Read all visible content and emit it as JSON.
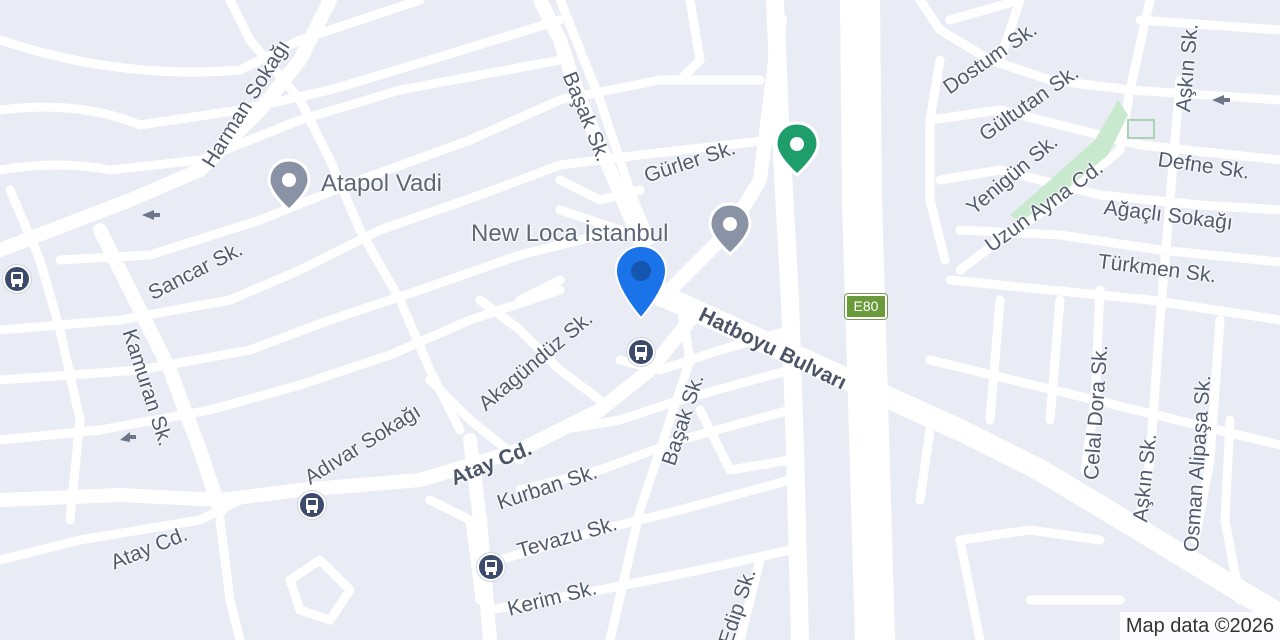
{
  "streets": [
    {
      "id": "harman",
      "name": "Harman Sokağı"
    },
    {
      "id": "basak-n",
      "name": "Başak Sk."
    },
    {
      "id": "gurler",
      "name": "Gürler Sk."
    },
    {
      "id": "dostum",
      "name": "Dostum Sk."
    },
    {
      "id": "gultutan",
      "name": "Gültutan Sk."
    },
    {
      "id": "askin-n",
      "name": "Aşkın Sk."
    },
    {
      "id": "yenigun",
      "name": "Yenigün Sk."
    },
    {
      "id": "defne",
      "name": "Defne Sk."
    },
    {
      "id": "uzun-ayna",
      "name": "Uzun Ayna Cd."
    },
    {
      "id": "agacli",
      "name": "Ağaçlı Sokağı"
    },
    {
      "id": "turkmen",
      "name": "Türkmen Sk."
    },
    {
      "id": "sancar",
      "name": "Sancar Sk."
    },
    {
      "id": "kamuran",
      "name": "Kamuran Sk."
    },
    {
      "id": "akagunduz",
      "name": "Akagündüz Sk."
    },
    {
      "id": "hatboyu",
      "name": "Hatboyu Bulvarı"
    },
    {
      "id": "adivar",
      "name": "Adıvar Sokağı"
    },
    {
      "id": "atay-main",
      "name": "Atay Cd."
    },
    {
      "id": "basak-s",
      "name": "Başak Sk."
    },
    {
      "id": "kurban",
      "name": "Kurban Sk."
    },
    {
      "id": "atay-w",
      "name": "Atay Cd."
    },
    {
      "id": "tevazu",
      "name": "Tevazu Sk."
    },
    {
      "id": "kerim",
      "name": "Kerim Sk."
    },
    {
      "id": "edip",
      "name": "Edip Sk."
    },
    {
      "id": "celal",
      "name": "Celal Dora Sk."
    },
    {
      "id": "askin-s",
      "name": "Aşkın Sk."
    },
    {
      "id": "osman",
      "name": "Osman Alipaşa Sk."
    }
  ],
  "places": [
    {
      "id": "atapol",
      "name": "Atapol Vadi",
      "icon": "place-pin-icon"
    },
    {
      "id": "newloca",
      "name": "New Loca İstanbul",
      "icon": "place-pin-icon"
    }
  ],
  "highway_shield": "E80",
  "attribution": "Map data ©2026",
  "markers": {
    "location": {
      "icon": "location-pin-icon",
      "color": "#1a73e8"
    },
    "green": {
      "icon": "park-pin-icon",
      "color": "#1e9e6a"
    },
    "bus": {
      "icon": "bus-stop-icon",
      "color": "#3c4a6b"
    }
  }
}
